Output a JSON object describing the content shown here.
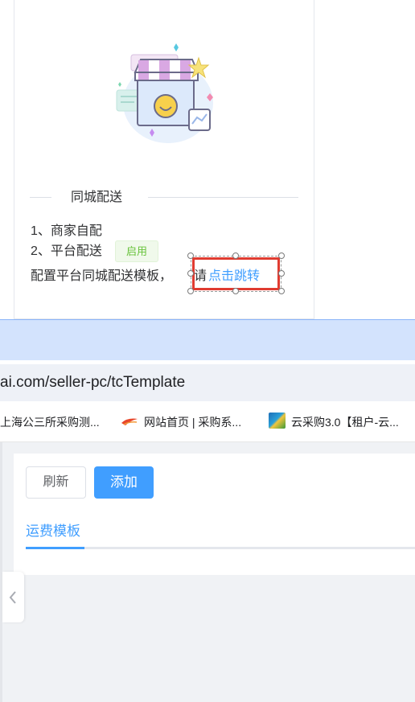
{
  "delivery": {
    "section_title": "同城配送",
    "line1": "1、商家自配",
    "line2": "2、平台配送",
    "enabled_badge": "启用",
    "line3_prefix": "配置平台同城配送模板，",
    "line3_qing": "请",
    "jump_link": "点击跳转",
    "highlight_color": "#e03c31",
    "link_color": "#409eff"
  },
  "browser": {
    "url": "ai.com/seller-pc/tcTemplate",
    "bookmarks": [
      {
        "label": "上海公三所采购测...",
        "icon": ""
      },
      {
        "label": "网站首页 | 采购系...",
        "icon": "site-logo-icon"
      },
      {
        "label": "云采购3.0【租户-云...",
        "icon": "landscape-thumb-icon"
      }
    ]
  },
  "page": {
    "refresh_label": "刷新",
    "add_label": "添加",
    "tab_freight": "运费模板",
    "primary_color": "#409eff"
  }
}
